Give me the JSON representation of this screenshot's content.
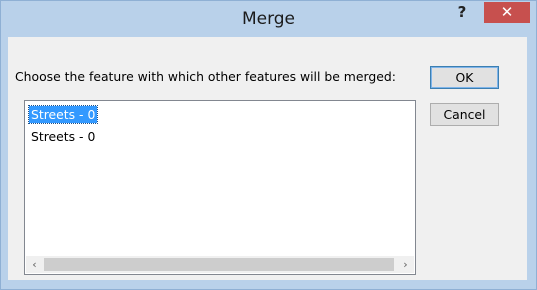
{
  "window": {
    "title": "Merge",
    "help_label": "?",
    "close_label": "✕"
  },
  "dialog": {
    "prompt": "Choose the feature with which other features will be merged:",
    "ok_label": "OK",
    "cancel_label": "Cancel"
  },
  "list": {
    "items": [
      {
        "label": "Streets - 0",
        "selected": true
      },
      {
        "label": "Streets - 0",
        "selected": false
      }
    ],
    "scroll_left_icon": "‹",
    "scroll_right_icon": "›"
  },
  "colors": {
    "titlebar": "#b9d1ea",
    "close": "#c7504e",
    "selection": "#3399ff"
  }
}
